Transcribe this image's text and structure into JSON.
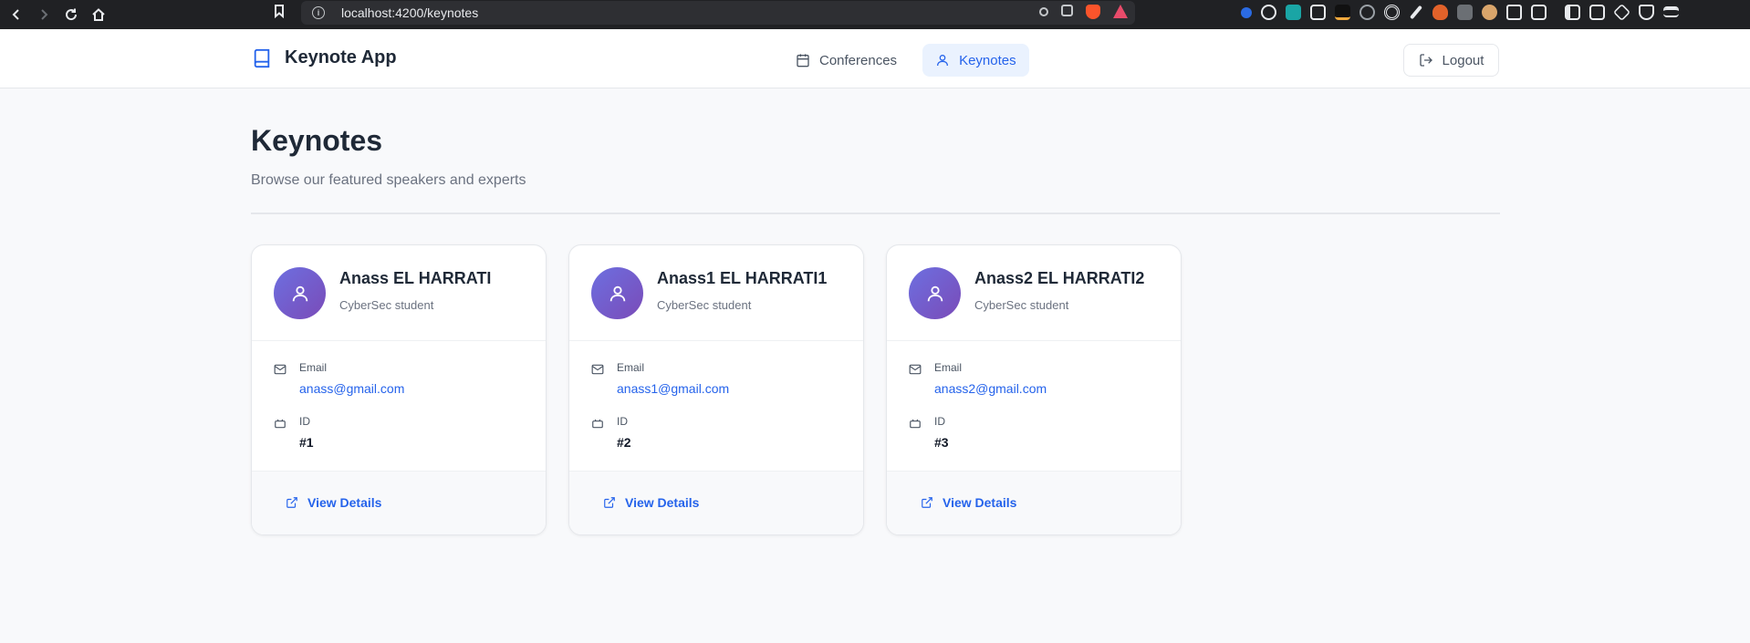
{
  "browser": {
    "url": "localhost:4200/keynotes"
  },
  "header": {
    "brand_title": "Keynote App",
    "nav": [
      {
        "label": "Conferences",
        "icon": "calendar-icon",
        "active": false
      },
      {
        "label": "Keynotes",
        "icon": "user-icon",
        "active": true
      }
    ],
    "logout_label": "Logout"
  },
  "main": {
    "title": "Keynotes",
    "subtitle": "Browse our featured speakers and experts",
    "email_label": "Email",
    "id_label": "ID",
    "view_details_label": "View Details",
    "cards": [
      {
        "name": "Anass EL HARRATI",
        "role": "CyberSec student",
        "email": "anass@gmail.com",
        "id": "#1"
      },
      {
        "name": "Anass1 EL HARRATI1",
        "role": "CyberSec student",
        "email": "anass1@gmail.com",
        "id": "#2"
      },
      {
        "name": "Anass2 EL HARRATI2",
        "role": "CyberSec student",
        "email": "anass2@gmail.com",
        "id": "#3"
      }
    ]
  },
  "colors": {
    "accent": "#2563eb",
    "avatar_gradient_start": "#6d6fe0",
    "avatar_gradient_end": "#7a4bb8"
  }
}
